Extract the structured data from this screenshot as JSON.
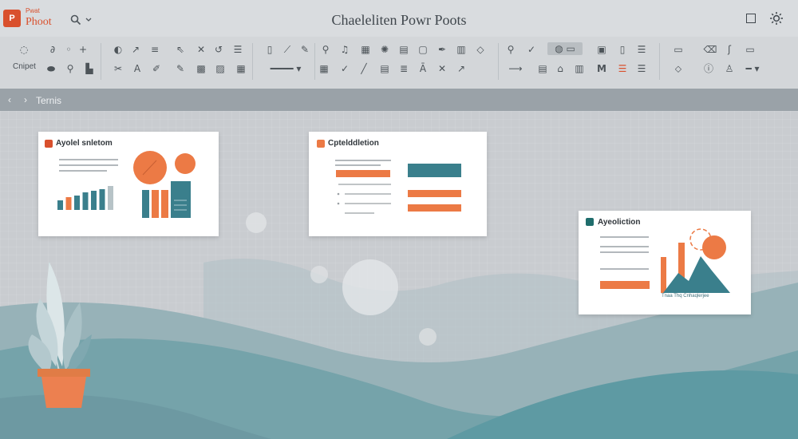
{
  "app": {
    "logo_text": "P",
    "name_small": "Pwat",
    "name": "Phoot"
  },
  "title": "Chaeleliten Powr Poots",
  "window_controls": {
    "maximize": "☐",
    "close": "☼"
  },
  "ribbon": {
    "group_label": "Cnipet"
  },
  "breadcrumb": {
    "back": "‹",
    "forward": "›",
    "label": "Ternis"
  },
  "slides": [
    {
      "title": "Ayolel snletom",
      "badge_color": "#d9502d",
      "chart_values": [
        12,
        16,
        18,
        22,
        24,
        26,
        30
      ]
    },
    {
      "title": "Cptelddletion",
      "badge_color": "#ec7a45"
    },
    {
      "title": "Ayeoliction",
      "badge_color": "#1f6d6c",
      "caption": "Tnaa Thq Cnhaqlerjee"
    }
  ],
  "colors": {
    "accent_orange": "#ec7a45",
    "accent_teal": "#3a7f8c",
    "line_gray": "#9aa0a5"
  }
}
